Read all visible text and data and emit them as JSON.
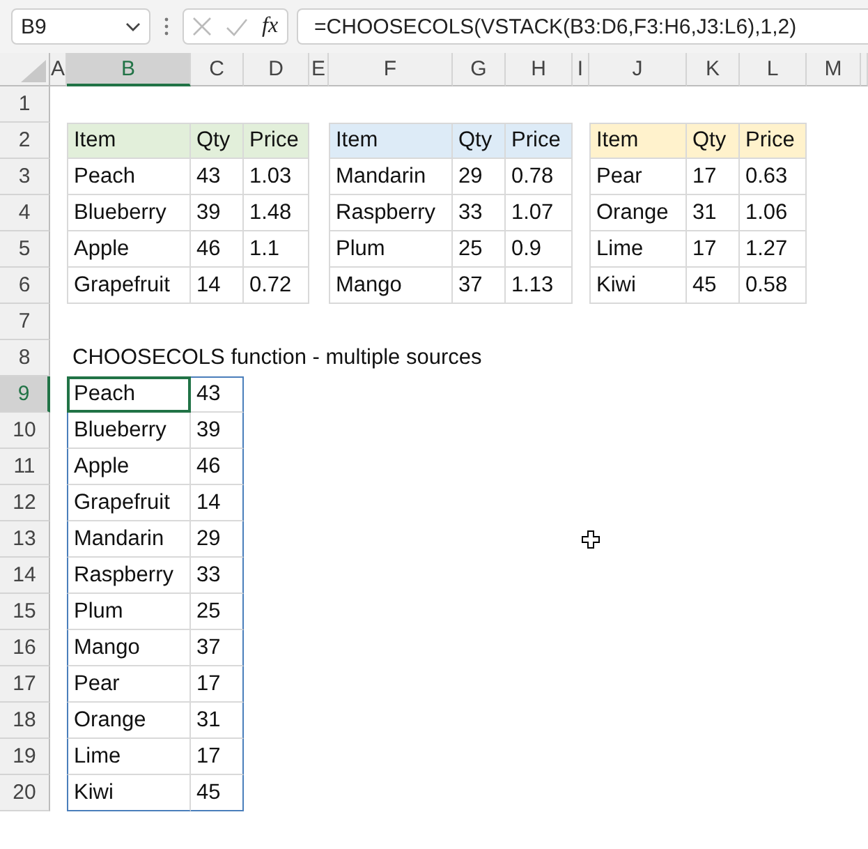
{
  "name_box": {
    "value": "B9"
  },
  "formula_bar": {
    "fx": "fx",
    "value": "=CHOOSECOLS(VSTACK(B3:D6,F3:H6,J3:L6),1,2)"
  },
  "columns": [
    {
      "label": "A",
      "selected": false
    },
    {
      "label": "B",
      "selected": true
    },
    {
      "label": "C",
      "selected": false
    },
    {
      "label": "D",
      "selected": false
    },
    {
      "label": "E",
      "selected": false
    },
    {
      "label": "F",
      "selected": false
    },
    {
      "label": "G",
      "selected": false
    },
    {
      "label": "H",
      "selected": false
    },
    {
      "label": "I",
      "selected": false
    },
    {
      "label": "J",
      "selected": false
    },
    {
      "label": "K",
      "selected": false
    },
    {
      "label": "L",
      "selected": false
    },
    {
      "label": "M",
      "selected": false
    }
  ],
  "rows": [
    {
      "label": "1",
      "selected": false
    },
    {
      "label": "2",
      "selected": false
    },
    {
      "label": "3",
      "selected": false
    },
    {
      "label": "4",
      "selected": false
    },
    {
      "label": "5",
      "selected": false
    },
    {
      "label": "6",
      "selected": false
    },
    {
      "label": "7",
      "selected": false
    },
    {
      "label": "8",
      "selected": false
    },
    {
      "label": "9",
      "selected": true
    },
    {
      "label": "10",
      "selected": false
    },
    {
      "label": "11",
      "selected": false
    },
    {
      "label": "12",
      "selected": false
    },
    {
      "label": "13",
      "selected": false
    },
    {
      "label": "14",
      "selected": false
    },
    {
      "label": "15",
      "selected": false
    },
    {
      "label": "16",
      "selected": false
    },
    {
      "label": "17",
      "selected": false
    },
    {
      "label": "18",
      "selected": false
    },
    {
      "label": "19",
      "selected": false
    },
    {
      "label": "20",
      "selected": false
    }
  ],
  "tables": [
    {
      "color": "#e2efda",
      "header": [
        "Item",
        "Qty",
        "Price"
      ],
      "rows": [
        [
          "Peach",
          "43",
          "1.03"
        ],
        [
          "Blueberry",
          "39",
          "1.48"
        ],
        [
          "Apple",
          "46",
          "1.1"
        ],
        [
          "Grapefruit",
          "14",
          "0.72"
        ]
      ]
    },
    {
      "color": "#ddebf7",
      "header": [
        "Item",
        "Qty",
        "Price"
      ],
      "rows": [
        [
          "Mandarin",
          "29",
          "0.78"
        ],
        [
          "Raspberry",
          "33",
          "1.07"
        ],
        [
          "Plum",
          "25",
          "0.9"
        ],
        [
          "Mango",
          "37",
          "1.13"
        ]
      ]
    },
    {
      "color": "#fff2cc",
      "header": [
        "Item",
        "Qty",
        "Price"
      ],
      "rows": [
        [
          "Pear",
          "17",
          "0.63"
        ],
        [
          "Orange",
          "31",
          "1.06"
        ],
        [
          "Lime",
          "17",
          "1.27"
        ],
        [
          "Kiwi",
          "45",
          "0.58"
        ]
      ]
    }
  ],
  "title": "CHOOSECOLS function - multiple sources",
  "result": [
    {
      "item": "Peach",
      "qty": "43",
      "selected": true
    },
    {
      "item": "Blueberry",
      "qty": "39",
      "selected": false
    },
    {
      "item": "Apple",
      "qty": "46",
      "selected": false
    },
    {
      "item": "Grapefruit",
      "qty": "14",
      "selected": false
    },
    {
      "item": "Mandarin",
      "qty": "29",
      "selected": false
    },
    {
      "item": "Raspberry",
      "qty": "33",
      "selected": false
    },
    {
      "item": "Plum",
      "qty": "25",
      "selected": false
    },
    {
      "item": "Mango",
      "qty": "37",
      "selected": false
    },
    {
      "item": "Pear",
      "qty": "17",
      "selected": false
    },
    {
      "item": "Orange",
      "qty": "31",
      "selected": false
    },
    {
      "item": "Lime",
      "qty": "17",
      "selected": false
    },
    {
      "item": "Kiwi",
      "qty": "45",
      "selected": false
    }
  ]
}
